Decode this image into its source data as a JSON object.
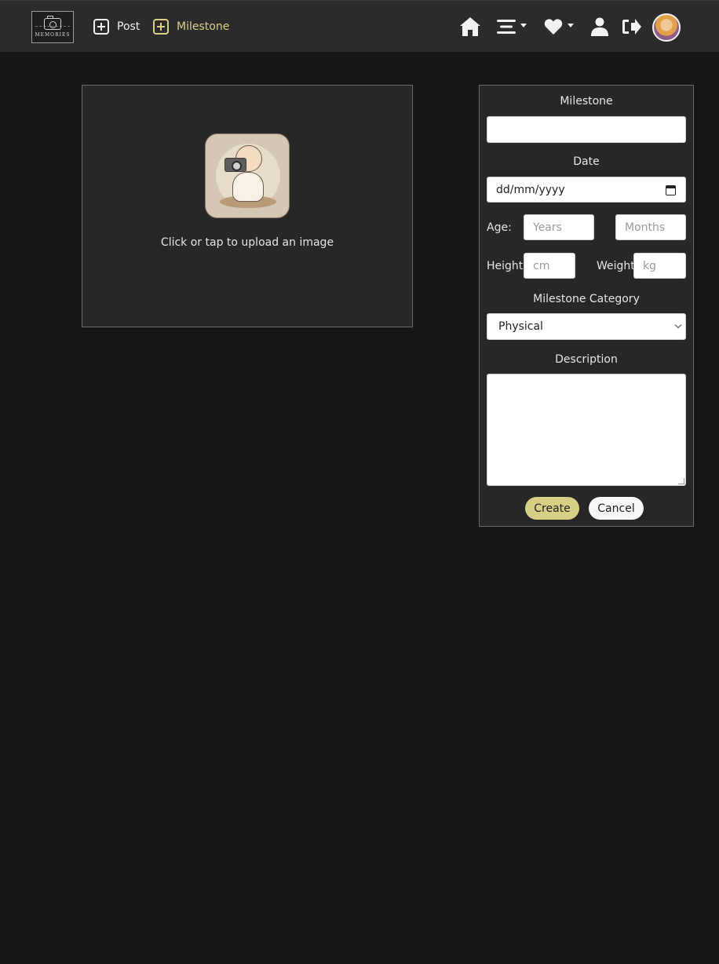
{
  "app": {
    "logo_text": "MEMORIES"
  },
  "nav": {
    "post_label": "Post",
    "milestone_label": "Milestone",
    "accent_color": "#d8cf87"
  },
  "nav_icons": [
    "plus-square-icon",
    "home-icon",
    "menu-bars-icon",
    "heart-icon",
    "user-icon",
    "logout-icon",
    "avatar"
  ],
  "upload": {
    "prompt": "Click or tap to upload an image"
  },
  "form": {
    "milestone_label": "Milestone",
    "milestone_value": "",
    "date_label": "Date",
    "date_placeholder": "dd/mm/yyyy",
    "age_label": "Age:",
    "years_placeholder": "Years",
    "months_placeholder": "Months",
    "height_label": "Height",
    "height_placeholder": "cm",
    "weight_label": "Weight",
    "weight_placeholder": "kg",
    "category_label": "Milestone Category",
    "category_selected": "Physical",
    "description_label": "Description",
    "description_value": "",
    "create_label": "Create",
    "cancel_label": "Cancel"
  }
}
